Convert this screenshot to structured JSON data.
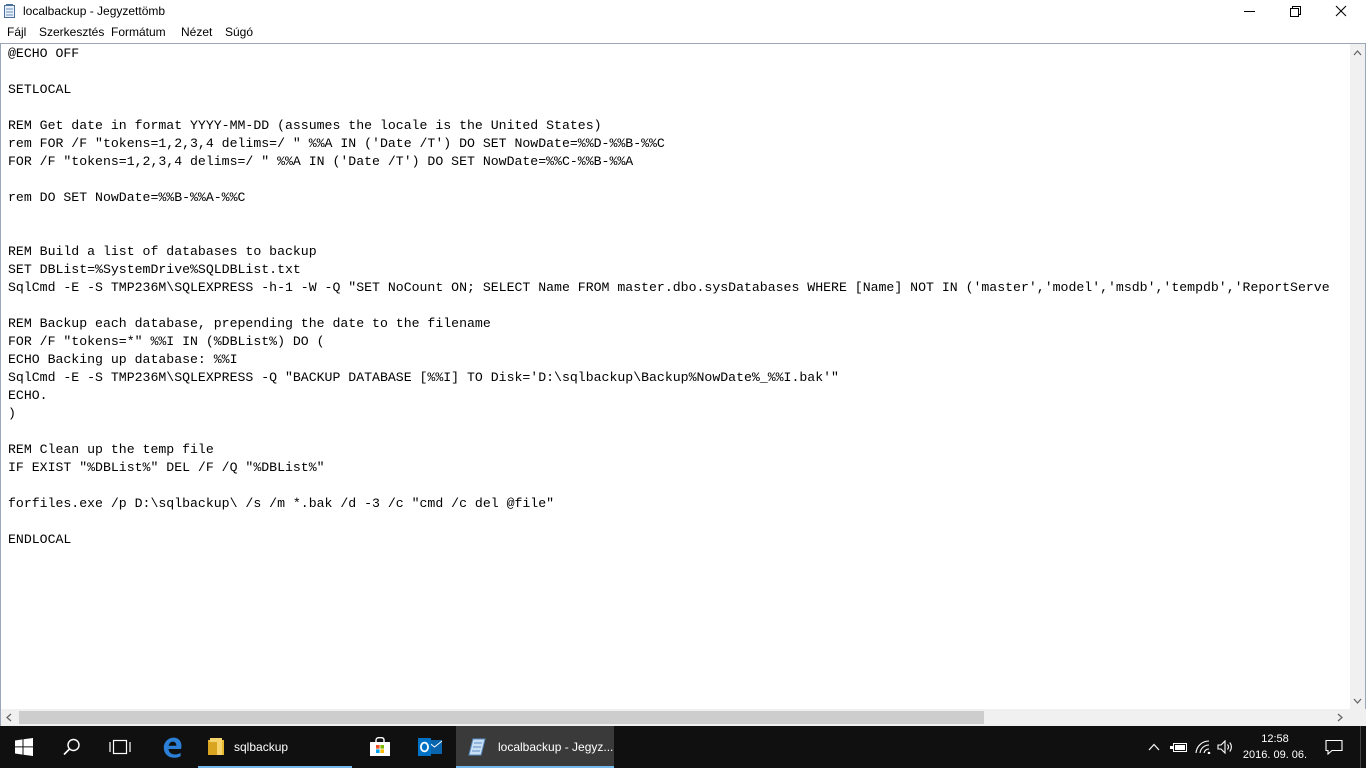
{
  "window": {
    "title": "localbackup - Jegyzettömb"
  },
  "menu": [
    "Fájl",
    "Szerkesztés",
    "Formátum",
    "Nézet",
    "Súgó"
  ],
  "editor": {
    "lines": [
      "@ECHO OFF",
      "",
      "SETLOCAL",
      "",
      "REM Get date in format YYYY-MM-DD (assumes the locale is the United States)",
      "rem FOR /F \"tokens=1,2,3,4 delims=/ \" %%A IN ('Date /T') DO SET NowDate=%%D-%%B-%%C",
      "FOR /F \"tokens=1,2,3,4 delims=/ \" %%A IN ('Date /T') DO SET NowDate=%%C-%%B-%%A",
      "",
      "rem DO SET NowDate=%%B-%%A-%%C",
      "",
      "",
      "REM Build a list of databases to backup",
      "SET DBList=%SystemDrive%SQLDBList.txt",
      "SqlCmd -E -S TMP236M\\SQLEXPRESS -h-1 -W -Q \"SET NoCount ON; SELECT Name FROM master.dbo.sysDatabases WHERE [Name] NOT IN ('master','model','msdb','tempdb','ReportServe",
      "",
      "REM Backup each database, prepending the date to the filename",
      "FOR /F \"tokens=*\" %%I IN (%DBList%) DO (",
      "ECHO Backing up database: %%I",
      "SqlCmd -E -S TMP236M\\SQLEXPRESS -Q \"BACKUP DATABASE [%%I] TO Disk='D:\\sqlbackup\\Backup%NowDate%_%%I.bak'\"",
      "ECHO.",
      ")",
      "",
      "REM Clean up the temp file",
      "IF EXIST \"%DBList%\" DEL /F /Q \"%DBList%\"",
      "",
      "forfiles.exe /p D:\\sqlbackup\\ /s /m *.bak /d -3 /c \"cmd /c del @file\"",
      "",
      "ENDLOCAL"
    ]
  },
  "taskbar": {
    "items": [
      {
        "name": "start-button",
        "icon": "windows-logo-icon"
      },
      {
        "name": "search-button",
        "icon": "search-icon"
      },
      {
        "name": "task-view-button",
        "icon": "task-view-icon"
      },
      {
        "name": "edge-button",
        "icon": "edge-icon"
      },
      {
        "name": "sqlbackup-explorer",
        "icon": "folder-icon",
        "label": "sqlbackup"
      },
      {
        "name": "store-button",
        "icon": "store-icon"
      },
      {
        "name": "outlook-button",
        "icon": "outlook-icon"
      },
      {
        "name": "notepad-task",
        "icon": "notepad-icon",
        "label": "localbackup - Jegyz..."
      }
    ],
    "time": "12:58",
    "date": "2016. 09. 06.",
    "colors": {
      "background": "#101010",
      "accent": "#76b9ed"
    }
  }
}
